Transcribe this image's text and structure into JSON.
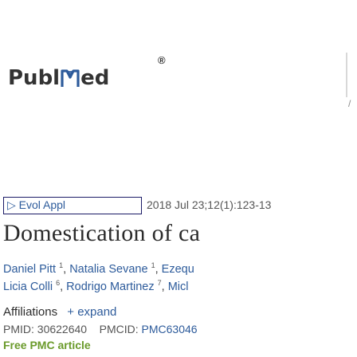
{
  "header": {
    "logo_left": "Publ",
    "logo_right": "ed",
    "logo_reg": "®",
    "slash": "/"
  },
  "citation": {
    "journal": "Evol Appl",
    "arrow": "▷",
    "info": "2018 Jul 23;12(1):123-13"
  },
  "article": {
    "title": "Domestication of ca",
    "authors_line1": [
      {
        "name": "Daniel Pitt",
        "sup": "1"
      },
      {
        "name": "Natalia Sevane",
        "sup": "1"
      },
      {
        "name": "Ezequ",
        "sup": ""
      }
    ],
    "authors_line2": [
      {
        "name": "Licia Colli",
        "sup": "6"
      },
      {
        "name": "Rodrigo Martinez",
        "sup": "7"
      },
      {
        "name": "Micl",
        "sup": ""
      }
    ],
    "affiliations_label": "Affiliations",
    "expand_label": "+ expand",
    "pmid_label": "PMID:",
    "pmid": "30622640",
    "pmcid_label": "PMCID:",
    "pmcid": "PMC63046",
    "free_label": "Free PMC article"
  },
  "colors": {
    "link": "#2d5b9b",
    "text": "#2b2b2b",
    "free": "#6a9a2a"
  }
}
